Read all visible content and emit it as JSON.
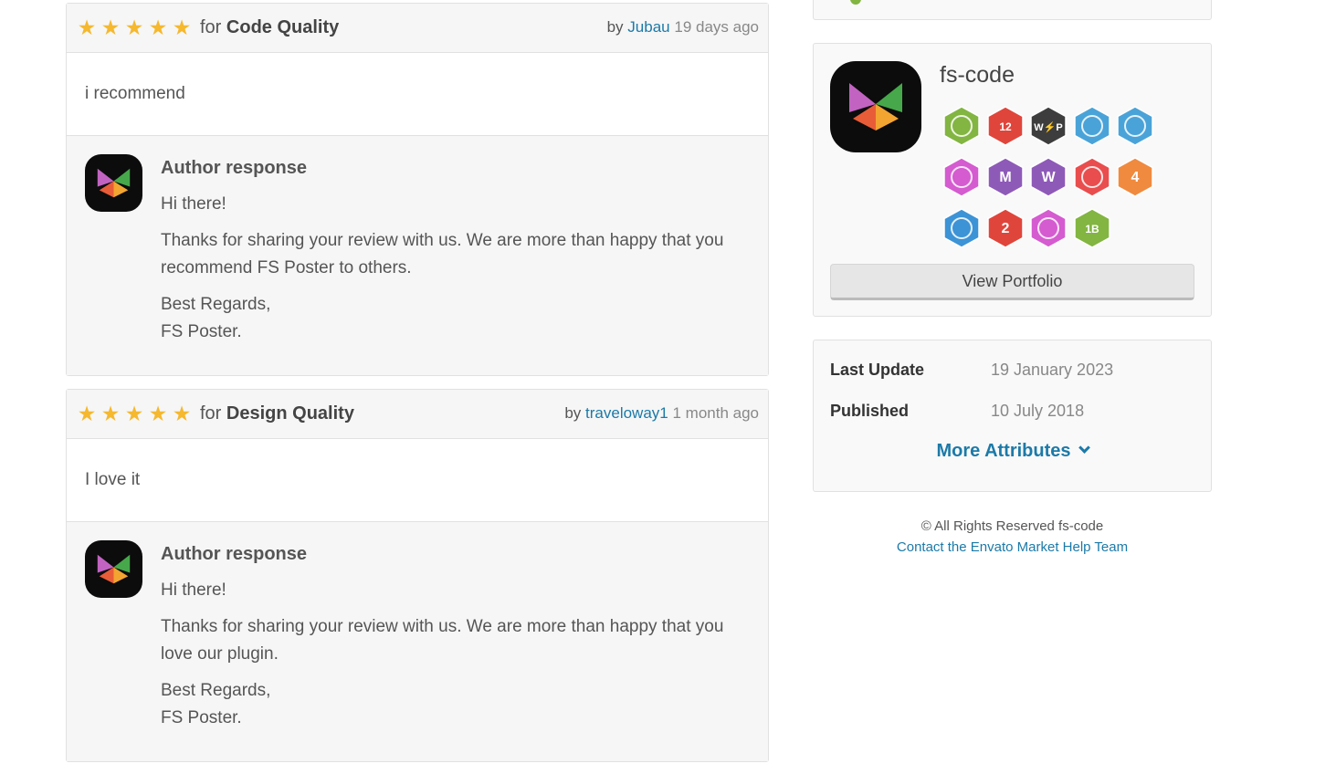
{
  "reviews": [
    {
      "stars": "★★★★★",
      "for_prefix": "for",
      "category": "Code Quality",
      "by": "by",
      "user": "Jubau",
      "ago": "19 days ago",
      "body": "i recommend",
      "response_title": "Author response",
      "greeting": "Hi there!",
      "message": "Thanks for sharing your review with us. We are more than happy that you recommend FS Poster to others.",
      "regards": "Best Regards,",
      "signature": "FS Poster."
    },
    {
      "stars": "★★★★★",
      "for_prefix": "for",
      "category": "Design Quality",
      "by": "by",
      "user": "traveloway1",
      "ago": "1 month ago",
      "body": "I love it",
      "response_title": "Author response",
      "greeting": "Hi there!",
      "message": "Thanks for sharing your review with us. We are more than happy that you love our plugin.",
      "regards": "Best Regards,",
      "signature": "FS Poster."
    }
  ],
  "author": {
    "name": "fs-code",
    "view_portfolio": "View Portfolio",
    "badges": [
      {
        "icon": "stack-icon",
        "color": "#82b541",
        "text": ""
      },
      {
        "icon": "paw-icon",
        "color": "#e0453b",
        "text": "12"
      },
      {
        "icon": "wp-lightning-icon",
        "color": "#3d3d3d",
        "text": "W⚡P"
      },
      {
        "icon": "person-icon",
        "color": "#4aa3d8",
        "text": ""
      },
      {
        "icon": "document-icon",
        "color": "#4aa3d8",
        "text": ""
      },
      {
        "icon": "bug-icon",
        "color": "#d55bd0",
        "text": ""
      },
      {
        "icon": "rocket-m-icon",
        "color": "#8e5ab8",
        "text": "M"
      },
      {
        "icon": "rocket-w-icon",
        "color": "#8e5ab8",
        "text": "W"
      },
      {
        "icon": "map-pin-icon",
        "color": "#e94d4d",
        "text": ""
      },
      {
        "icon": "flame-4-icon",
        "color": "#f08a3e",
        "text": "4"
      },
      {
        "icon": "bolt-icon",
        "color": "#3c93d6",
        "text": ""
      },
      {
        "icon": "chip-icon",
        "color": "#e0453b",
        "text": "2"
      },
      {
        "icon": "diamond-icon",
        "color": "#d55bd0",
        "text": ""
      },
      {
        "icon": "leaf-1b-icon",
        "color": "#82b541",
        "text": "1B"
      }
    ]
  },
  "attributes": {
    "last_update_label": "Last Update",
    "last_update_value": "19 January 2023",
    "published_label": "Published",
    "published_value": "10 July 2018",
    "more": "More Attributes"
  },
  "footer": {
    "copyright": "© All Rights Reserved fs-code",
    "contact": "Contact the Envato Market Help Team"
  },
  "colors": {
    "link": "#1c7aa8",
    "star": "#f5b82e",
    "panel": "#f6f6f6"
  }
}
